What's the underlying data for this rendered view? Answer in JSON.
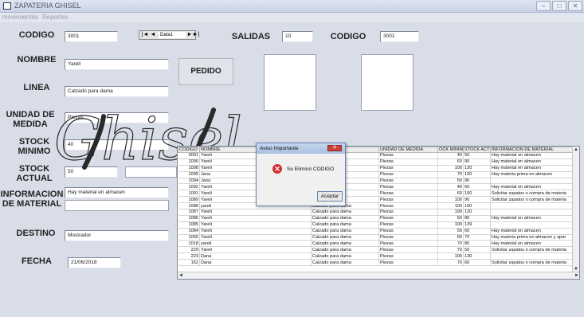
{
  "window": {
    "title": "ZAPATERIA GHISEL",
    "controls": [
      "–",
      "□",
      "✕"
    ]
  },
  "menu": [
    "movimientos",
    "Reportes"
  ],
  "form": {
    "codigo_label": "CODIGO",
    "codigo_value": "3001",
    "nombre_label": "NOMBRE",
    "nombre_value": "Yareli",
    "linea_label": "LINEA",
    "linea_value": "Calzado para dama",
    "unidad_label_1": "UNIDAD DE",
    "unidad_label_2": "MEDIDA",
    "unidad_value": "Piezas",
    "stock_min_label_1": "STOCK",
    "stock_min_label_2": "MINIMO",
    "stock_min_value": "40",
    "stock_act_label_1": "STOCK",
    "stock_act_label_2": "ACTUAL",
    "stock_act_value": "50",
    "info_label_1": "INFORMACION",
    "info_label_2": "DE MATERIAL",
    "info_value": "Hay material en almacen",
    "destino_label": "DESTINO",
    "destino_value": "Mostrador",
    "fecha_label": "FECHA",
    "fecha_value": "21/06/2018"
  },
  "navigator": {
    "caption": "Data1",
    "first": "|◄",
    "prev": "◄",
    "next": "►",
    "last": "►|"
  },
  "salidas": {
    "label": "SALIDAS",
    "value": "10",
    "codigo_label": "CODIGO",
    "codigo_value": "3001"
  },
  "pedido_label": "PEDIDO",
  "watermark_text": "Ghisel",
  "grid": {
    "columns": [
      "CODIGO",
      "NOMBRE",
      "",
      "UNIDAD DE MEDIDA",
      "OCK MINIMO",
      "STOCK ACT",
      "INFORMACION DE MATERIAL"
    ],
    "rows": [
      [
        "3001",
        "Yareli",
        "a",
        "Piezas",
        "40",
        "50",
        "Hay material en almacen"
      ],
      [
        "1090",
        "Yareli",
        "a",
        "Piezas",
        "60",
        "90",
        "Hay material en almacen"
      ],
      [
        "1098",
        "Yareli",
        "a",
        "Piezas",
        "100",
        "120",
        "Hay material en almacen"
      ],
      [
        "1095",
        "Jana",
        "a",
        "Piezas",
        "70",
        "100",
        "Hay materia prima en almacen"
      ],
      [
        "1094",
        "Jana",
        "a",
        "Piezas",
        "50",
        "90",
        ""
      ],
      [
        "1092",
        "Yareli",
        "a",
        "Piezas",
        "40",
        "60",
        "Hay material en almacen"
      ],
      [
        "1091",
        "Yareli",
        "a",
        "Piezas",
        "60",
        "100",
        "Solicitar zapatos o compra de materia"
      ],
      [
        "1089",
        "Yareli",
        "a",
        "Piezas",
        "100",
        "90",
        "Solicitar zapatos o compra de materia"
      ],
      [
        "1088",
        "yareli",
        "Calzado para dama",
        "Piezas",
        "100",
        "150",
        ""
      ],
      [
        "1087",
        "Yareli",
        "Calzado para dama",
        "Piezas",
        "199",
        "120",
        ""
      ],
      [
        "1086",
        "Yareli",
        "Calzado para dama",
        "Piezas",
        "50",
        "80",
        "Hay material en almacen"
      ],
      [
        "1085",
        "Yareli",
        "Calzado para dama",
        "Piezas",
        "100",
        "139",
        ""
      ],
      [
        "1084",
        "Yareli",
        "Calzado para dama",
        "Piezas",
        "50",
        "60",
        "Hay material en almacen"
      ],
      [
        "1065",
        "Yareli",
        "Calzado para dama",
        "Piezas",
        "60",
        "70",
        "Hay materia prima en almacen y apar"
      ],
      [
        "1018",
        "yareli",
        "Calzado para dama",
        "Piezas",
        "70",
        "80",
        "Hay material en almacen"
      ],
      [
        "229",
        "Yareli",
        "Calzado para dama",
        "Piezas",
        "70",
        "50",
        "Solicitar zapatos o compra de materia"
      ],
      [
        "223",
        "Dana",
        "Calzado para dama",
        "Piezas",
        "100",
        "130",
        ""
      ],
      [
        "152",
        "Dana",
        "Calzado para dama",
        "Piezas",
        "70",
        "60",
        "Solicitar zapatos o compra de materia"
      ]
    ]
  },
  "dialog": {
    "title": "Aviso Importante",
    "close": "✕",
    "icon": "✕",
    "message": "Se Eliminó CODIGO",
    "ok": "Aceptar"
  }
}
